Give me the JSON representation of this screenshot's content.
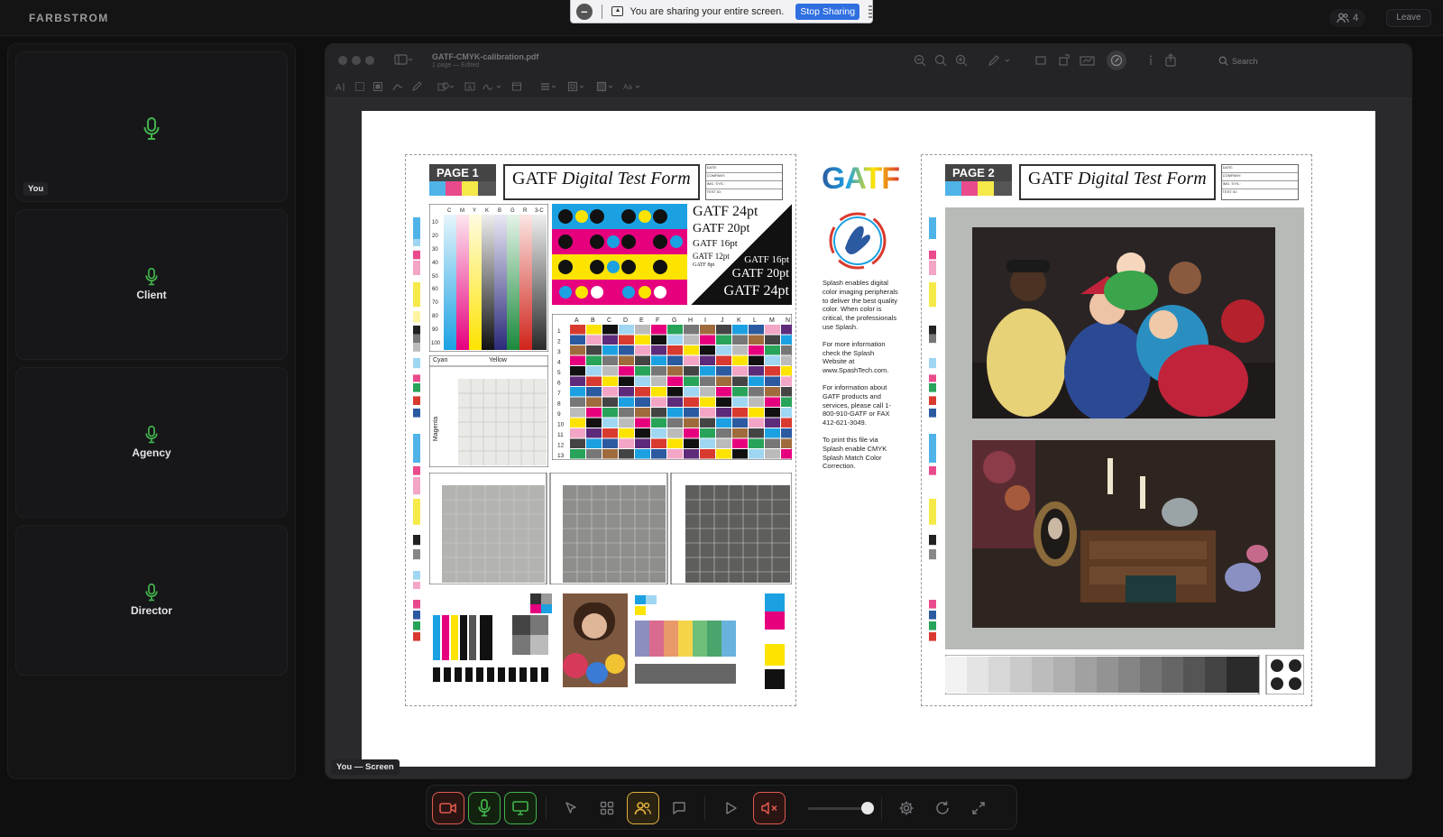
{
  "app": {
    "brand": "FARBSTROM"
  },
  "share_banner": {
    "message": "You are sharing your entire screen.",
    "stop_label": "Stop Sharing"
  },
  "header": {
    "participant_count": "4",
    "leave_label": "Leave"
  },
  "participants": [
    {
      "name": "",
      "tag": "You"
    },
    {
      "name": "Client"
    },
    {
      "name": "Agency"
    },
    {
      "name": "Director"
    }
  ],
  "preview": {
    "file_name": "GATF-CMYK-calibration.pdf",
    "file_sub": "1 page — Edited",
    "search_label": "Search"
  },
  "test_form": {
    "page1_label": "PAGE 1",
    "page2_label": "PAGE 2",
    "title_plain": "GATF",
    "title_italic": "Digital Test Form",
    "meta_fields": [
      "DATE:",
      "COMPANY:",
      "IMG. SYS.:",
      "TEST ID:"
    ],
    "logo_text": "GATF",
    "font_samples": [
      "GATF 24pt",
      "GATF 20pt",
      "GATF 16pt",
      "GATF 12pt",
      "GATF 8pt"
    ],
    "side_note": [
      "Splash enables digital color imaging peripherals to deliver the best quality color. When color is critical, the professionals use Splash.",
      "For more information check the Splash Website at www.SpashTech.com.",
      "For information about GATF products and services, please call 1-800-910-GATF or FAX 412-621-3049.",
      "To print this file via Splash enable CMYK Splash Match Color Correction."
    ],
    "ink_headers": [
      "C",
      "M",
      "Y",
      "K",
      "B",
      "G",
      "R",
      "3-C"
    ],
    "tint_rows": [
      "10",
      "20",
      "30",
      "40",
      "50",
      "60",
      "70",
      "80",
      "90",
      "100"
    ],
    "grid_cols": [
      "A",
      "B",
      "C",
      "D",
      "E",
      "F",
      "G",
      "H",
      "I",
      "J",
      "K",
      "L",
      "M",
      "N"
    ],
    "cyan_label": "Cyan",
    "yellow_label": "Yellow",
    "magenta_label": "Magenta"
  },
  "screen_tag": "You — Screen",
  "controls": {
    "items": [
      "camera",
      "microphone",
      "screen-share",
      "pointer",
      "grid-view",
      "participants",
      "chat",
      "play",
      "mute-speaker",
      "settings",
      "refresh",
      "fullscreen"
    ]
  },
  "colors": {
    "mic_green": "#43b44d",
    "stop_blue": "#2f6fe0",
    "alert_red": "#e05a4e",
    "accent_yellow": "#e3b23c"
  }
}
